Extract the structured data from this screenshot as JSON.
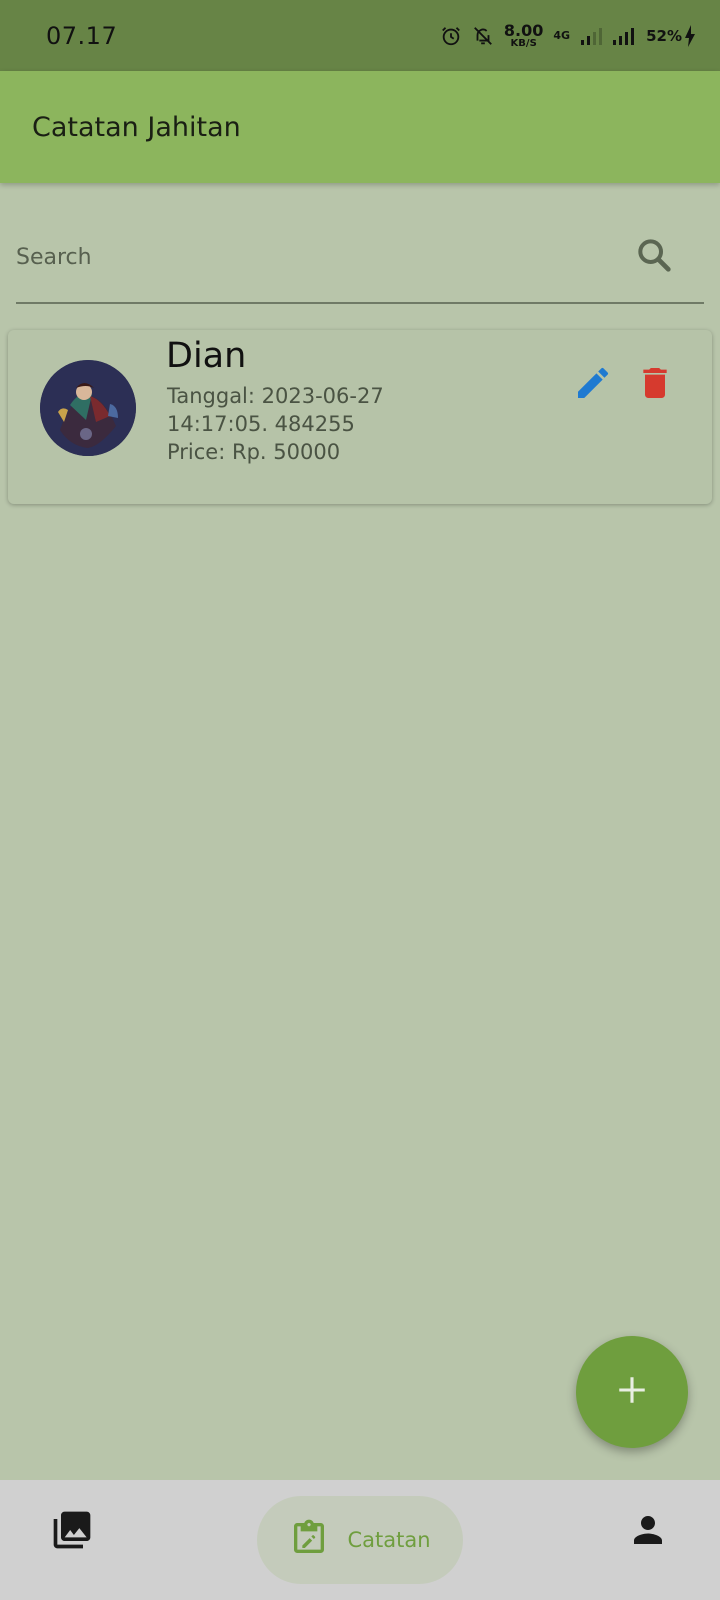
{
  "status_bar": {
    "time": "07.17",
    "speed_value": "8.00",
    "speed_unit": "KB/S",
    "network": "4G",
    "battery": "52%"
  },
  "app_bar": {
    "title": "Catatan Jahitan"
  },
  "search": {
    "placeholder": "Search",
    "icon": "search-icon"
  },
  "notes": [
    {
      "name": "Dian",
      "date_line": "Tanggal: 2023-06-27",
      "time_line": "14:17:05. 484255",
      "price_line": "Price: Rp.   50000",
      "edit_icon": "pencil-icon",
      "delete_icon": "trash-icon"
    }
  ],
  "fab": {
    "icon": "plus-icon"
  },
  "bottom_nav": {
    "items": [
      {
        "icon": "gallery-icon",
        "label": ""
      },
      {
        "icon": "clipboard-edit-icon",
        "label": "Catatan",
        "active": true
      },
      {
        "icon": "person-icon",
        "label": ""
      }
    ]
  },
  "colors": {
    "status_bar": "#678446",
    "app_bar": "#8cb55d",
    "background": "#b8c5aa",
    "accent": "#6f9e3e",
    "edit": "#1f7ad1",
    "delete": "#d63a2e",
    "nav_bg": "#d0d0d0"
  }
}
